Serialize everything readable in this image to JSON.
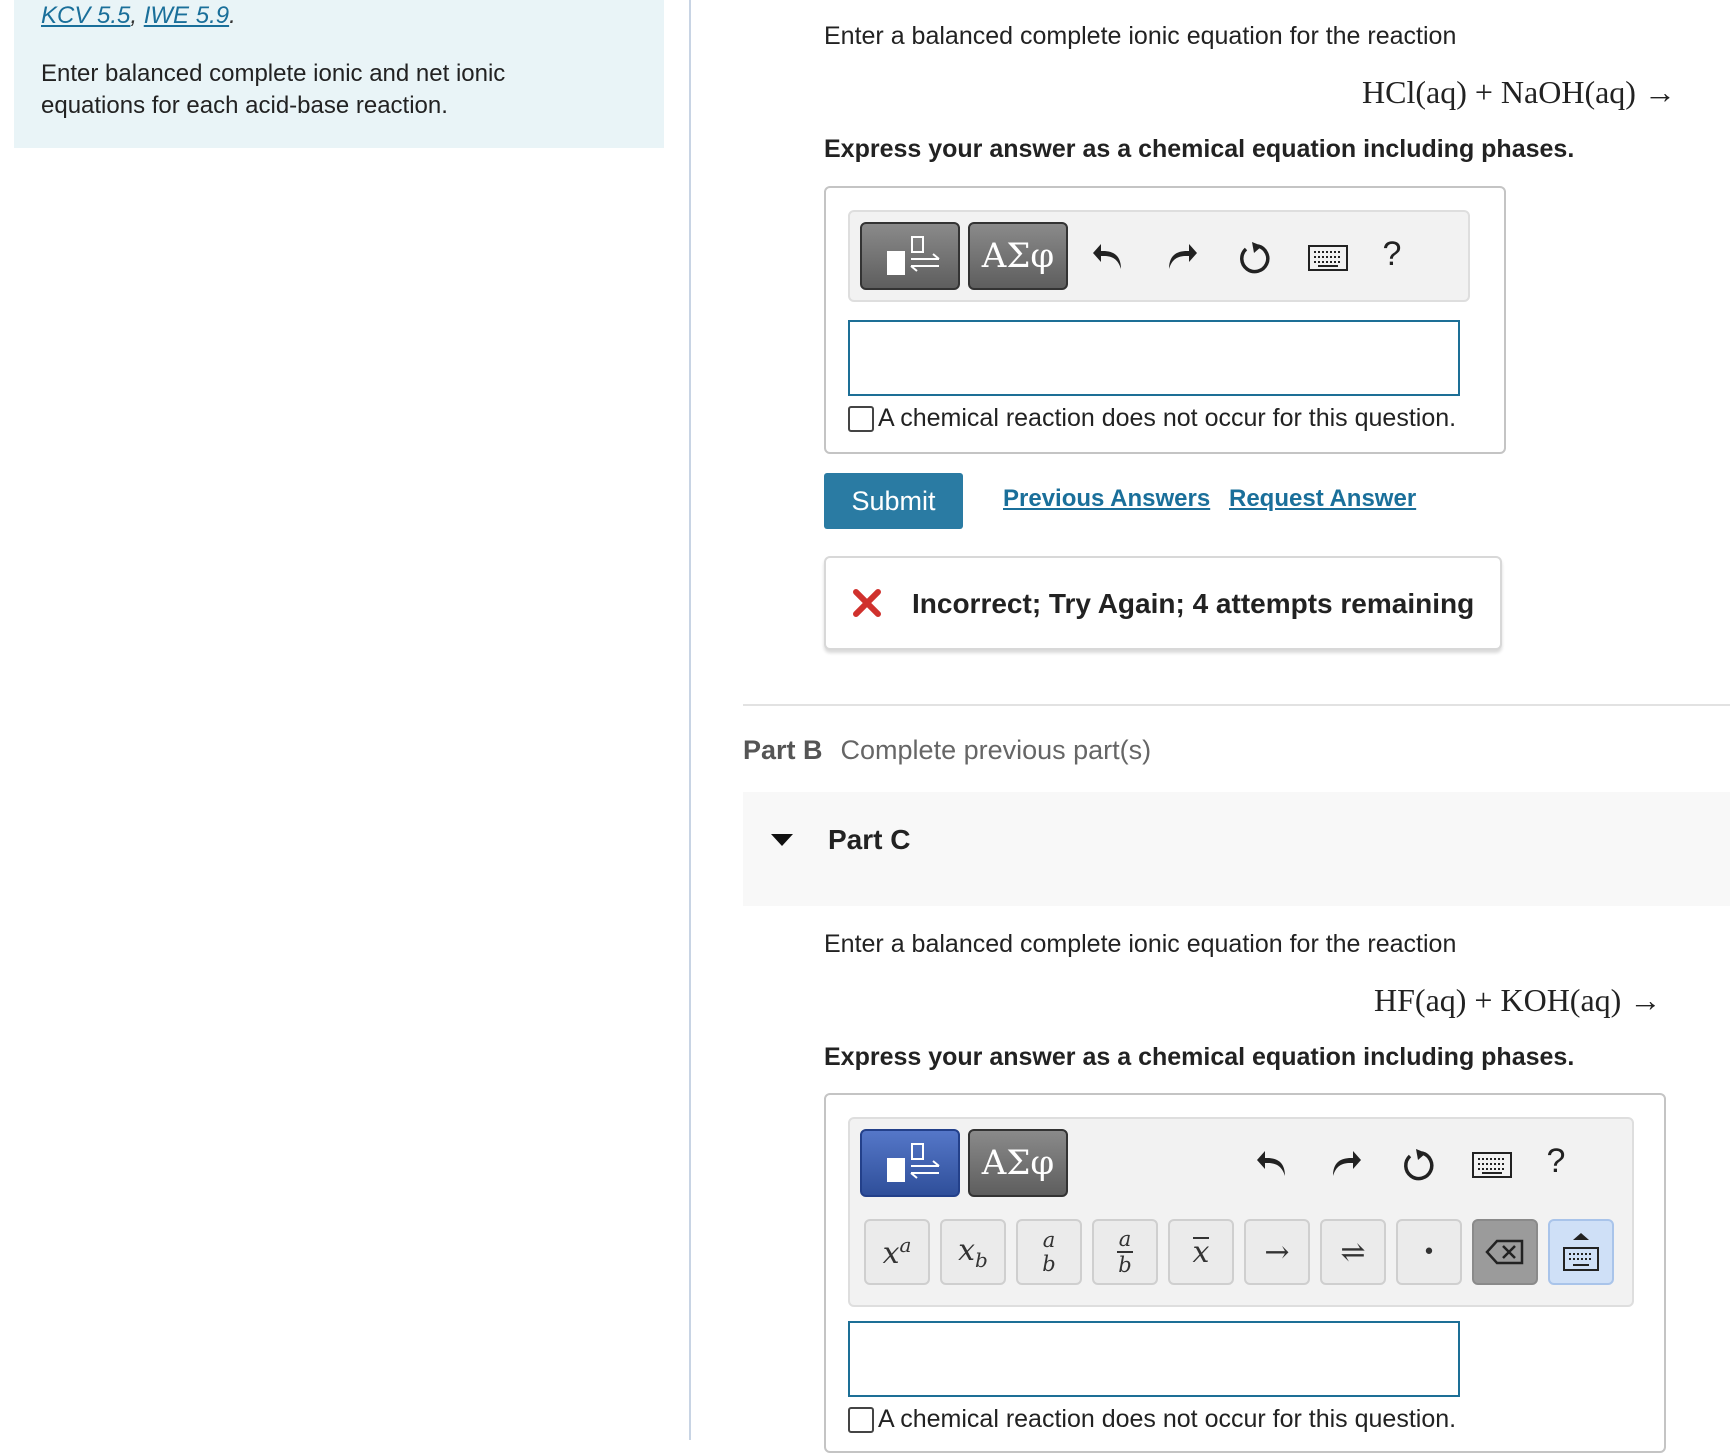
{
  "left": {
    "ref1": "KCV 5.5",
    "ref_sep": ",",
    "ref2": "IWE 5.9",
    "ref_end": ".",
    "instructions": "Enter balanced complete ionic and net ionic equations for each acid-base reaction."
  },
  "partA": {
    "prompt": "Enter a balanced complete ionic equation for the reaction",
    "equation": "HCl(aq) + NaOH(aq) →",
    "express": "Express your answer as a chemical equation including phases.",
    "toolbar": {
      "greek_label": "ΑΣφ",
      "help_label": "?"
    },
    "answer_value": "",
    "no_reaction_label": "A chemical reaction does not occur for this question.",
    "submit_label": "Submit",
    "previous_answers_label": "Previous Answers",
    "request_answer_label": "Request Answer",
    "feedback": "Incorrect; Try Again; 4 attempts remaining"
  },
  "partB": {
    "label": "Part B",
    "status": "Complete previous part(s)"
  },
  "partC": {
    "label": "Part C",
    "prompt": "Enter a balanced complete ionic equation for the reaction",
    "equation": "HF(aq) + KOH(aq) →",
    "express": "Express your answer as a chemical equation including phases.",
    "toolbar": {
      "greek_label": "ΑΣφ",
      "help_label": "?"
    },
    "keypad": {
      "superscript_base": "x",
      "superscript_exp": "a",
      "subscript_base": "x",
      "subscript_sub": "b",
      "frac_top": "a",
      "frac_bottom": "b",
      "frac2_top": "a",
      "frac2_bottom": "b",
      "overbar": "x",
      "arrow": "→",
      "equilibrium": "⇌",
      "dot": "•"
    },
    "answer_value": "",
    "no_reaction_label": "A chemical reaction does not occur for this question."
  },
  "colors": {
    "accent": "#2a7ba3",
    "link": "#1a6f9a",
    "error": "#d0312d",
    "panel_bg": "#e9f4f7"
  }
}
